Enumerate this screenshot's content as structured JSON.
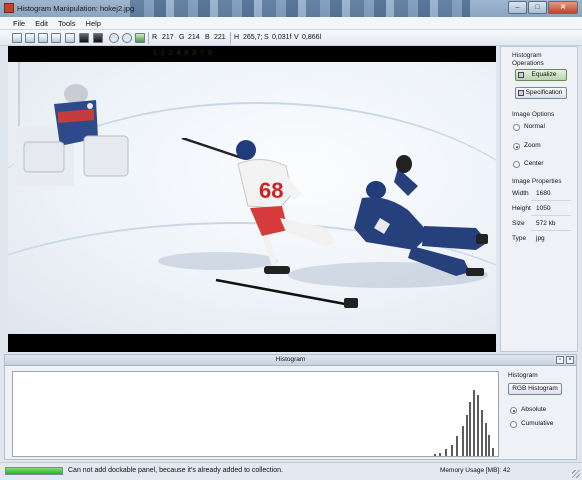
{
  "window": {
    "title": "Histogram Manipulation: hokej2.jpg"
  },
  "menu": [
    "File",
    "Edit",
    "Tools",
    "Help"
  ],
  "readout": {
    "r_label": "R",
    "r_value": "217",
    "g_label": "G",
    "g_value": "214",
    "b_label": "B",
    "b_value": "221",
    "h_label": "H",
    "h_value": "265,7;",
    "s_label": "S",
    "s_value": "0,031f",
    "v_label": "V",
    "v_value": "0,866l"
  },
  "canvas": {
    "overlay_text": "1 1 2 4 8 9 7 9"
  },
  "side_panel": {
    "histogram_operations": "Histogram Operations",
    "equalize_label": "Equalize",
    "specification_label": "Specification",
    "image_options": "Image Options",
    "options": [
      {
        "label": "Normal",
        "selected": false
      },
      {
        "label": "Zoom",
        "selected": true
      },
      {
        "label": "Center",
        "selected": false
      }
    ],
    "image_properties": "Image Properties",
    "properties": [
      {
        "label": "Width",
        "value": "1680"
      },
      {
        "label": "Height",
        "value": "1050"
      },
      {
        "label": "Size",
        "value": "572 kb"
      },
      {
        "label": "Type",
        "value": "jpg"
      }
    ]
  },
  "histogram_panel": {
    "title": "Histogram",
    "side_heading": "Histogram",
    "rgb_button": "RGB Histogram",
    "modes": [
      {
        "label": "Absolute",
        "selected": true
      },
      {
        "label": "Cumulative",
        "selected": false
      }
    ]
  },
  "chart_data": {
    "type": "bar",
    "x": [
      223,
      226,
      229,
      232,
      235,
      238,
      240,
      242,
      244,
      246,
      248,
      250,
      252,
      254
    ],
    "values": [
      2,
      4,
      8,
      14,
      24,
      36,
      50,
      66,
      80,
      74,
      56,
      40,
      26,
      10
    ],
    "xlim": [
      0,
      255
    ],
    "ylim": [
      0,
      100
    ]
  },
  "statusbar": {
    "progress": 1.0,
    "message": "Can not add dockable panel, because it's already added to collection.",
    "memory_label": "Memory Usage [MB]:",
    "memory_value": "42"
  },
  "colors": {
    "progress": "#27b21f",
    "histogram": "#5d5d5d"
  },
  "icons": [
    "app-icon",
    "minimize-icon",
    "maximize-icon",
    "close-icon",
    "new-icon",
    "open-icon",
    "save-icon",
    "print-icon",
    "copy-icon",
    "grayscale-icon",
    "invert-icon",
    "undo-icon",
    "redo-icon",
    "refresh-icon",
    "tree-icon"
  ]
}
